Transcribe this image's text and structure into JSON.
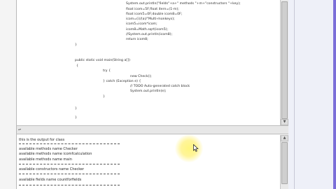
{
  "code_lines": [
    "System.out.println(\"fields\"+a+\" methods \"+m+\"constructors \"+key);",
    "float icom=5F;float itern=(1-m);",
    "float icom5=0F;double icom8=0F;",
    "icom=(i)/(a)/\"Multi-monkeys);",
    "icom5=icom*icom;",
    "icom8=Math.sqrt(icom5);",
    "//System.out.println(icom8);",
    "return icom8;",
    "}",
    "public static void main(String a[])",
    "{",
    "try {",
    "new Check();",
    "} catch (Exception e) {",
    "// TODO Auto-generated catch block",
    "System.out.println(e);",
    "}",
    "}",
    "}"
  ],
  "output_lines": [
    "this is the output for class",
    "available methods name     Checker",
    "available methods name     icomfcalculation",
    "available methods name     main",
    "available constructors name     Checker",
    "available fields name     countforfields"
  ],
  "colors": {
    "accent": "#7b6fd8",
    "cursor_highlight": "#fff176"
  },
  "icons": [
    "mouse-pointer-icon",
    "scroll-up-arrow-icon",
    "scroll-down-arrow-icon",
    "splitter-grip-icon"
  ]
}
